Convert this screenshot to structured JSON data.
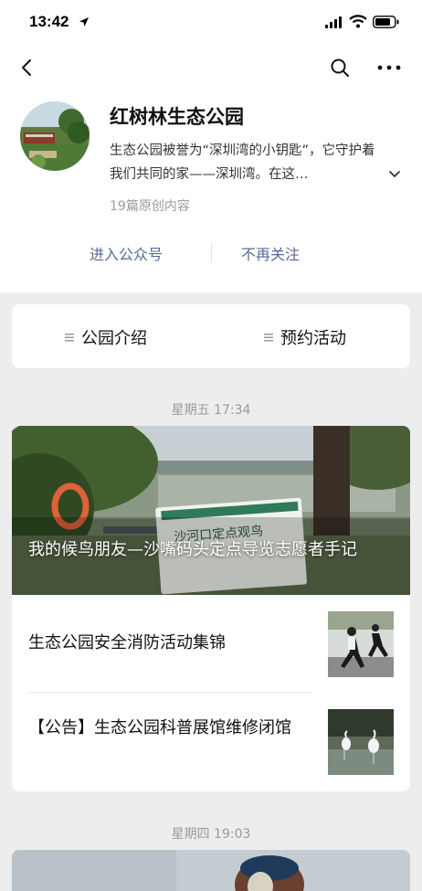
{
  "status_bar": {
    "time": "13:42"
  },
  "account": {
    "name": "红树林生态公园",
    "description": "生态公园被誉为“深圳湾的小钥匙”，它守护着我们共同的家——深圳湾。在这…",
    "article_count": "19篇原创内容"
  },
  "actions": {
    "enter": "进入公众号",
    "unfollow": "不再关注"
  },
  "menu": {
    "items": [
      {
        "label": "公园介绍"
      },
      {
        "label": "预约活动"
      }
    ]
  },
  "feed": {
    "groups": [
      {
        "date": "星期五 17:34",
        "cover_title": "我的候鸟朋友—沙嘴码头定点导览志愿者手记",
        "sign_text": "沙河口定点观鸟",
        "articles": [
          {
            "title": "生态公园安全消防活动集锦"
          },
          {
            "title": "【公告】生态公园科普展馆维修闭馆"
          }
        ]
      },
      {
        "date": "星期四 19:03"
      }
    ]
  },
  "colors": {
    "link": "#576b95",
    "background": "#ededed",
    "card": "#ffffff",
    "muted": "#9a9a9a"
  }
}
